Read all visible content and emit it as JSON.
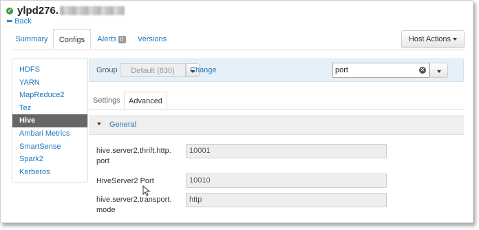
{
  "header": {
    "host_name": "ylpd276.",
    "back_label": "Back"
  },
  "tabs": [
    {
      "label": "Summary"
    },
    {
      "label": "Configs"
    },
    {
      "label": "Alerts"
    },
    {
      "label": "Versions"
    }
  ],
  "alerts_badge": "0",
  "host_actions_label": "Host Actions",
  "sidebar": {
    "items": [
      {
        "label": "HDFS"
      },
      {
        "label": "YARN"
      },
      {
        "label": "MapReduce2"
      },
      {
        "label": "Tez"
      },
      {
        "label": "Hive"
      },
      {
        "label": "Ambari Metrics"
      },
      {
        "label": "SmartSense"
      },
      {
        "label": "Spark2"
      },
      {
        "label": "Kerberos"
      }
    ],
    "active": "Hive"
  },
  "group": {
    "label": "Group",
    "selected": "Default (830)",
    "change_label": "Change"
  },
  "search": {
    "value": "port"
  },
  "subtabs": [
    {
      "label": "Settings"
    },
    {
      "label": "Advanced"
    }
  ],
  "section": {
    "title": "General"
  },
  "properties": [
    {
      "label": "hive.server2.thrift.http.\nport",
      "value": "10001"
    },
    {
      "label": "HiveServer2 Port",
      "value": "10010"
    },
    {
      "label": "hive.server2.transport.\nmode",
      "value": "http"
    }
  ],
  "colors": {
    "link": "#1c75bb",
    "active_sidebar": "#666666",
    "group_bar": "#e5f0f8",
    "status_ok": "#3c9a3c"
  }
}
